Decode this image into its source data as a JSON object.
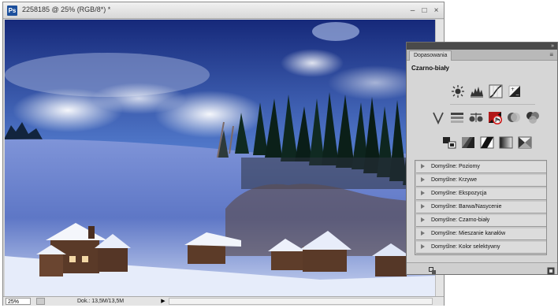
{
  "document": {
    "title": "2258185 @ 25% (RGB/8*) *",
    "app_icon_label": "Ps",
    "window_controls": {
      "minimize": "–",
      "maximize": "□",
      "close": "×"
    },
    "status": {
      "zoom": "25%",
      "doc_info": "Dok.: 13,5M/13,5M",
      "menu_arrow": "▶"
    }
  },
  "adjustments_panel": {
    "tab_label": "Dopasowania",
    "collapse_icon": "double-chevron-right-icon",
    "menu_icon": "panel-menu-icon",
    "heading": "Czarno-biały",
    "icon_rows": [
      [
        "brightness-contrast-icon",
        "levels-icon",
        "curves-icon",
        "exposure-icon"
      ],
      [
        "vibrance-icon",
        "hue-saturation-icon",
        "color-balance-icon",
        "black-white-icon",
        "photo-filter-icon",
        "channel-mixer-icon"
      ],
      [
        "invert-icon",
        "posterize-icon",
        "threshold-icon",
        "gradient-map-icon",
        "selective-color-icon"
      ]
    ],
    "highlighted_icon": "black-white-icon",
    "highlight_color": "#d11a1a",
    "presets": [
      "Domyślne: Poziomy",
      "Domyślne: Krzywe",
      "Domyślne: Ekspozycja",
      "Domyślne: Barwa/Nasycenie",
      "Domyślne: Czarno-biały",
      "Domyślne: Mieszanie kanałów",
      "Domyślne: Kolor selektywny"
    ],
    "footer_icons": [
      "clip-to-layer-icon",
      "new-adjustment-icon"
    ]
  }
}
